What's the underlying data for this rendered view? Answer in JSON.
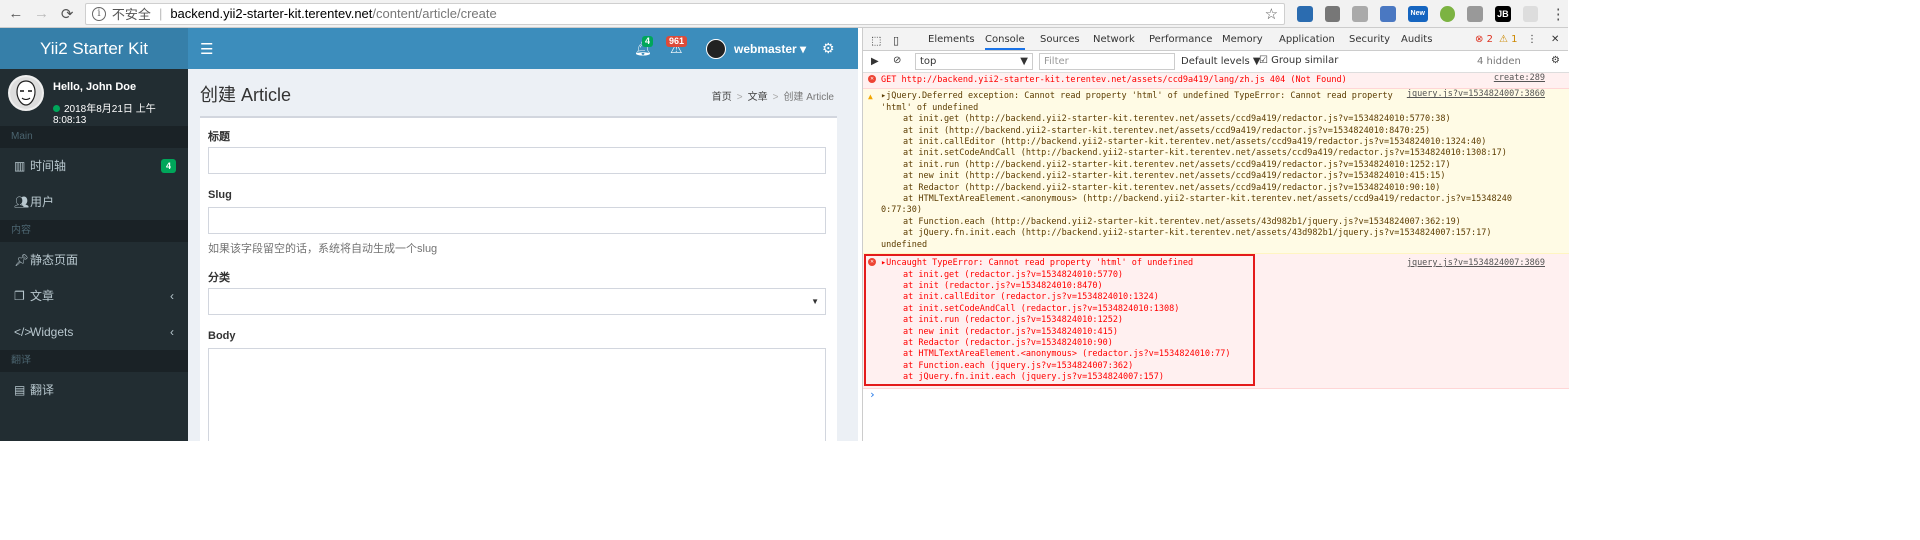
{
  "browser": {
    "insecure": "不安全",
    "url_host": "backend.yii2-starter-kit.terentev.net",
    "url_path": "/content/article/create",
    "ext_new": "New",
    "ext_jb": "JB"
  },
  "header": {
    "brand": "Yii2 Starter Kit",
    "notif_count": "4",
    "alert_count": "961",
    "username": "webmaster"
  },
  "sidebar": {
    "hello": "Hello, John Doe",
    "datetime": "2018年8月21日 上午8:08:13",
    "sections": [
      "Main",
      "内容",
      "翻译"
    ],
    "items": [
      {
        "label": "时间轴",
        "badge": "4"
      },
      {
        "label": "用户"
      },
      {
        "label": "静态页面"
      },
      {
        "label": "文章"
      },
      {
        "label": "Widgets"
      },
      {
        "label": "翻译"
      }
    ]
  },
  "page": {
    "title": "创建 Article",
    "breadcrumb": [
      "首页",
      "文章",
      "创建 Article"
    ],
    "form": {
      "title_label": "标题",
      "slug_label": "Slug",
      "slug_help": "如果该字段留空的话，系统将自动生成一个slug",
      "category_label": "分类",
      "body_label": "Body"
    }
  },
  "devtools": {
    "tabs": [
      "Elements",
      "Console",
      "Sources",
      "Network",
      "Performance",
      "Memory",
      "Application",
      "Security",
      "Audits"
    ],
    "error_count": "2",
    "warn_count": "1",
    "context": "top",
    "filter_placeholder": "Filter",
    "levels": "Default levels",
    "group_similar": "Group similar",
    "hidden": "4 hidden",
    "messages": [
      {
        "type": "error",
        "text": "GET http://backend.yii2-starter-kit.terentev.net/assets/ccd9a419/lang/zh.js 404 (Not Found)",
        "source": "create:289"
      },
      {
        "type": "warn",
        "text": "▸jQuery.Deferred exception: Cannot read property 'html' of undefined TypeError: Cannot read property 'html' of undefined",
        "source": "jquery.js?v=1534824007:3860",
        "trace": [
          "at init.get (http://backend.yii2-starter-kit.terentev.net/assets/ccd9a419/redactor.js?v=1534824010:5770:38)",
          "at init (http://backend.yii2-starter-kit.terentev.net/assets/ccd9a419/redactor.js?v=1534824010:8470:25)",
          "at init.callEditor (http://backend.yii2-starter-kit.terentev.net/assets/ccd9a419/redactor.js?v=1534824010:1324:40)",
          "at init.setCodeAndCall (http://backend.yii2-starter-kit.terentev.net/assets/ccd9a419/redactor.js?v=1534824010:1308:17)",
          "at init.run (http://backend.yii2-starter-kit.terentev.net/assets/ccd9a419/redactor.js?v=1534824010:1252:17)",
          "at new init (http://backend.yii2-starter-kit.terentev.net/assets/ccd9a419/redactor.js?v=1534824010:415:15)",
          "at Redactor (http://backend.yii2-starter-kit.terentev.net/assets/ccd9a419/redactor.js?v=1534824010:90:10)",
          "at HTMLTextAreaElement.<anonymous> (http://backend.yii2-starter-kit.terentev.net/assets/ccd9a419/redactor.js?v=15348240",
          "0:77:30)",
          "at Function.each (http://backend.yii2-starter-kit.terentev.net/assets/43d982b1/jquery.js?v=1534824007:362:19)",
          "at jQuery.fn.init.each (http://backend.yii2-starter-kit.terentev.net/assets/43d982b1/jquery.js?v=1534824007:157:17)",
          "undefined"
        ]
      },
      {
        "type": "error",
        "text": "▸Uncaught TypeError: Cannot read property 'html' of undefined",
        "source": "jquery.js?v=1534824007:3869",
        "trace": [
          "at init.get (redactor.js?v=1534824010:5770)",
          "at init (redactor.js?v=1534824010:8470)",
          "at init.callEditor (redactor.js?v=1534824010:1324)",
          "at init.setCodeAndCall (redactor.js?v=1534824010:1308)",
          "at init.run (redactor.js?v=1534824010:1252)",
          "at new init (redactor.js?v=1534824010:415)",
          "at Redactor (redactor.js?v=1534824010:90)",
          "at HTMLTextAreaElement.<anonymous> (redactor.js?v=1534824010:77)",
          "at Function.each (jquery.js?v=1534824007:362)",
          "at jQuery.fn.init.each (jquery.js?v=1534824007:157)"
        ]
      }
    ],
    "prompt": "›"
  }
}
